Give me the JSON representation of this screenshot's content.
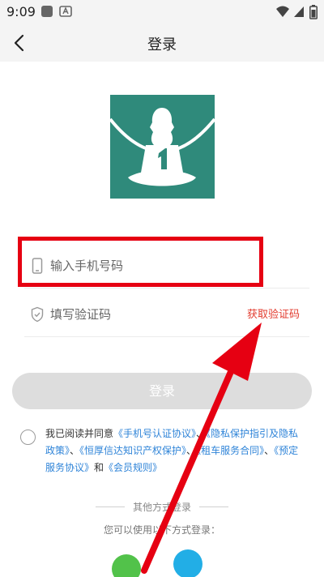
{
  "status_bar": {
    "time": "9:09"
  },
  "nav": {
    "title": "登录"
  },
  "form": {
    "phone_placeholder": "输入手机号码",
    "code_placeholder": "填写验证码",
    "get_code_label": "获取验证码"
  },
  "login_button": {
    "label": "登录"
  },
  "agreement": {
    "prefix": "我已阅读并同意",
    "doc1": "《手机号认证协议》",
    "sep1": "、",
    "doc2": "《隐私保护指引及隐私政策》",
    "sep2": "、",
    "doc3": "《恒厚信达知识产权保护》",
    "sep3": "、",
    "doc4": "《租车服务合同》",
    "sep4": "、",
    "doc5": "《预定服务协议》",
    "and": "和",
    "doc6": "《会员规则》"
  },
  "other_login": {
    "title": "其他方式登录",
    "hint": "您可以使用以下方式登录："
  },
  "colors": {
    "logo_bg": "#2f8a7b",
    "login_button_disabled": "#dddddd",
    "link": "#2f84d8",
    "annotation_red": "#e60012",
    "wechat_green": "#52c24a",
    "alipay_blue": "#22aee6"
  }
}
